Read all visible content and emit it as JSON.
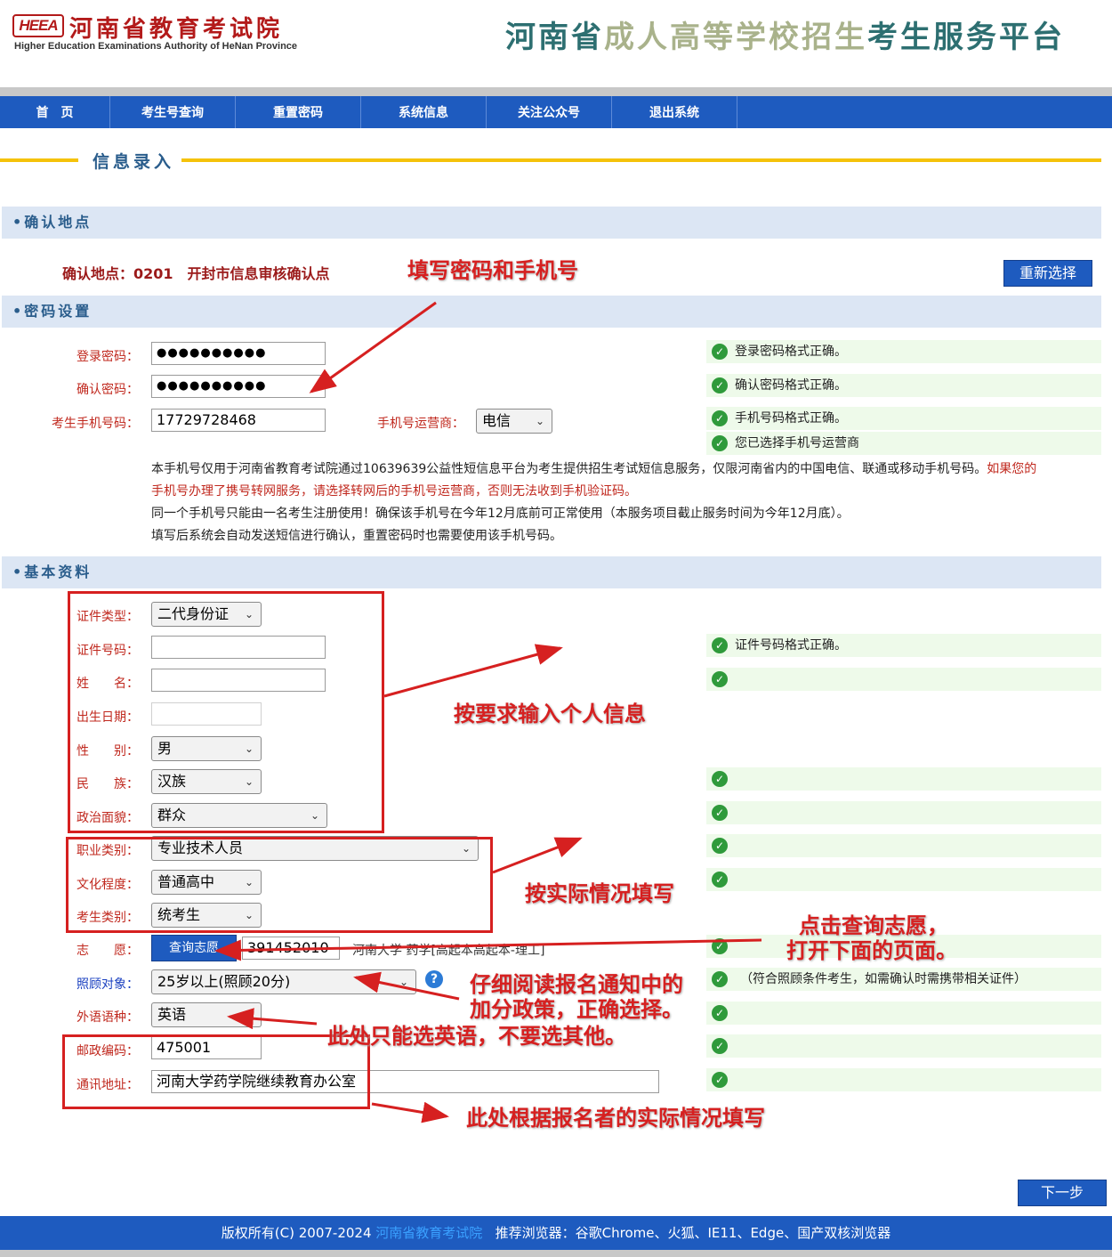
{
  "header": {
    "logo_abbr": "HEEA",
    "logo_cn": "河南省教育考试院",
    "logo_en": "Higher Education Examinations Authority of HeNan Province",
    "platform_title_a": "河南省",
    "platform_title_b": "成人高等学校招生",
    "platform_title_c": "考生服务平台"
  },
  "nav": [
    "首　页",
    "考生号查询",
    "重置密码",
    "系统信息",
    "关注公众号",
    "退出系统"
  ],
  "page_title": "信息录入",
  "sections": {
    "location": "确认地点",
    "password": "密码设置",
    "basic": "基本资料"
  },
  "location": {
    "text": "确认地点：0201　开封市信息审核确认点",
    "reselect_button": "重新选择"
  },
  "password_form": {
    "login_label": "登录密码：",
    "login_value": "●●●●●●●●●●",
    "confirm_label": "确认密码：",
    "confirm_value": "●●●●●●●●●●",
    "phone_label": "考生手机号码：",
    "phone_value": "17729728468",
    "carrier_label": "手机号运营商：",
    "carrier_value": "电信"
  },
  "password_status": [
    "登录密码格式正确。",
    "确认密码格式正确。",
    "手机号码格式正确。",
    "您已选择手机号运营商"
  ],
  "notes": {
    "line1a": "本手机号仅用于河南省教育考试院通过10639639公益性短信息平台为考生提供招生考试短信息服务，仅限河南省内的中国电信、联通或移动手机号码。",
    "line1b": "如果您的",
    "line2": "手机号办理了携号转网服务，请选择转网后的手机号运营商，否则无法收到手机验证码。",
    "line3": "同一个手机号只能由一名考生注册使用！确保该手机号在今年12月底前可正常使用（本服务项目截止服务时间为今年12月底）。",
    "line4": "填写后系统会自动发送短信进行确认，重置密码时也需要使用该手机号码。"
  },
  "basic_form": {
    "id_type_label": "证件类型：",
    "id_type_value": "二代身份证",
    "id_number_label": "证件号码：",
    "name_label": "姓　　名：",
    "birth_label": "出生日期：",
    "gender_label": "性　　别：",
    "gender_value": "男",
    "ethnic_label": "民　　族：",
    "ethnic_value": "汉族",
    "political_label": "政治面貌：",
    "political_value": "群众",
    "job_label": "职业类别：",
    "job_value": "专业技术人员",
    "edu_label": "文化程度：",
    "edu_value": "普通高中",
    "type_label": "考生类别：",
    "type_value": "统考生",
    "wish_label": "志　　愿：",
    "wish_button": "查询志愿",
    "wish_code": "391452010",
    "wish_text": "河南大学 药学[高起本高起本-理工]",
    "care_label": "照顾对象：",
    "care_value": "25岁以上(照顾20分)",
    "lang_label": "外语语种：",
    "lang_value": "英语",
    "zip_label": "邮政编码：",
    "zip_value": "475001",
    "addr_label": "通讯地址：",
    "addr_value": "河南大学药学院继续教育办公室"
  },
  "basic_status": {
    "id_number": "证件号码格式正确。",
    "care": "（符合照顾条件考生，如需确认时需携带相关证件）"
  },
  "annotations": {
    "fill_password": "填写密码和手机号",
    "personal_info": "按要求输入个人信息",
    "actual": "按实际情况填写",
    "wish1": "点击查询志愿，",
    "wish2": "打开下面的页面。",
    "policy1": "仔细阅读报名通知中的",
    "policy2": "加分政策，正确选择。",
    "english": "此处只能选英语，不要选其他。",
    "address": "此处根据报名者的实际情况填写"
  },
  "next_button": "下一步",
  "footer": {
    "copyright": "版权所有(C) 2007-2024",
    "org_link": "河南省教育考试院",
    "browsers": "推荐浏览器：谷歌Chrome、火狐、IE11、Edge、国产双核浏览器"
  },
  "colors": {
    "nav_blue": "#1e5bbf",
    "accent_yellow": "#f5c20a",
    "label_red": "#c0281e",
    "annotation_red": "#d62020",
    "band_blue": "#dce6f4",
    "ok_green": "#2f9a3b"
  }
}
